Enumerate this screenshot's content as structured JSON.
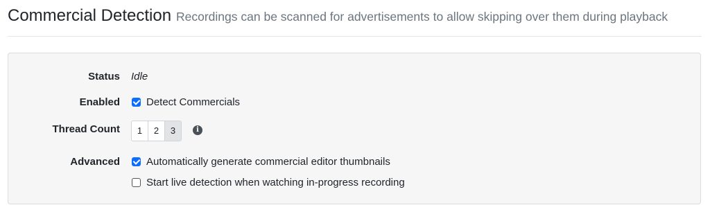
{
  "header": {
    "title": "Commercial Detection",
    "subtitle": "Recordings can be scanned for advertisements to allow skipping over them during playback"
  },
  "form": {
    "status": {
      "label": "Status",
      "value": "Idle"
    },
    "enabled": {
      "label": "Enabled",
      "checkbox_label": "Detect Commercials",
      "checked": true
    },
    "thread_count": {
      "label": "Thread Count",
      "options": [
        "1",
        "2",
        "3"
      ],
      "selected": "3",
      "info_icon": "info-circle-icon"
    },
    "advanced": {
      "label": "Advanced",
      "options": [
        {
          "label": "Automatically generate commercial editor thumbnails",
          "checked": true
        },
        {
          "label": "Start live detection when watching in-progress recording",
          "checked": false
        }
      ]
    }
  },
  "colors": {
    "accent": "#0d6efd",
    "panel_bg": "#f6f6f7",
    "subtitle": "#6c757d"
  }
}
